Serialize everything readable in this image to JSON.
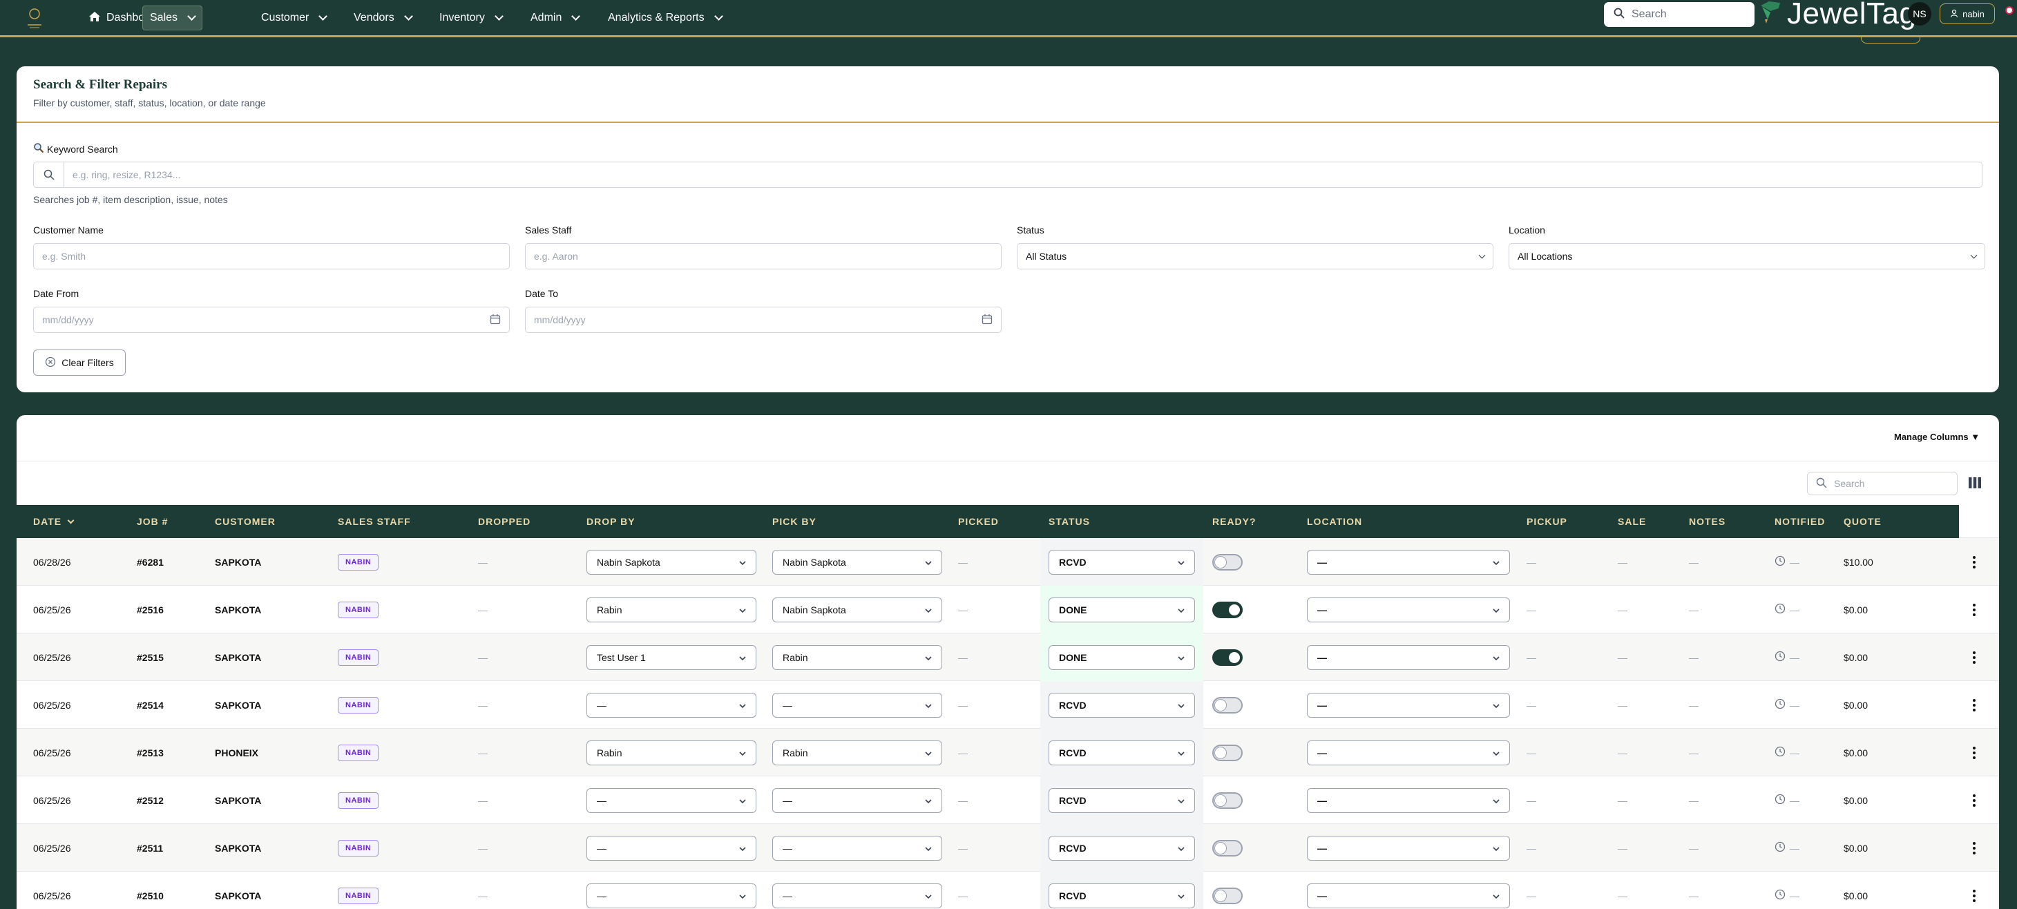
{
  "nav": {
    "items": [
      {
        "label": "Dashboard",
        "icon": "home-icon",
        "dropdown": false
      },
      {
        "label": "Sales",
        "dropdown": true,
        "active": true
      },
      {
        "label": "Customer",
        "dropdown": true
      },
      {
        "label": "Vendors",
        "dropdown": true
      },
      {
        "label": "Inventory",
        "dropdown": true
      },
      {
        "label": "Admin",
        "dropdown": true
      },
      {
        "label": "Analytics & Reports",
        "dropdown": true
      }
    ],
    "search_placeholder": "Search",
    "brand": "JewelTag",
    "avatar_initials": "NS",
    "user": "nabin"
  },
  "filters": {
    "title": "Search & Filter Repairs",
    "subtitle": "Filter by customer, staff, status, location, or date range",
    "keyword_label": "Keyword Search",
    "keyword_placeholder": "e.g. ring, resize, R1234...",
    "keyword_hint": "Searches job #, item description, issue, notes",
    "customer_label": "Customer Name",
    "customer_placeholder": "e.g. Smith",
    "staff_label": "Sales Staff",
    "staff_placeholder": "e.g. Aaron",
    "status_label": "Status",
    "status_value": "All Status",
    "location_label": "Location",
    "location_value": "All Locations",
    "date_from_label": "Date From",
    "date_from_placeholder": "mm/dd/yyyy",
    "date_to_label": "Date To",
    "date_to_placeholder": "mm/dd/yyyy",
    "clear_label": "Clear Filters"
  },
  "table": {
    "manage_columns": "Manage Columns ▼",
    "search_placeholder": "Search",
    "columns": [
      "DATE",
      "JOB #",
      "CUSTOMER",
      "SALES STAFF",
      "DROPPED",
      "DROP BY",
      "PICK BY",
      "PICKED",
      "STATUS",
      "READY?",
      "LOCATION",
      "PICKUP",
      "SALE",
      "NOTES",
      "NOTIFIED",
      "QUOTE"
    ],
    "rows": [
      {
        "date": "06/28/26",
        "job": "#6281",
        "customer": "SAPKOTA",
        "staff": "NABIN",
        "dropped": "—",
        "drop_by": "Nabin Sapkota",
        "pick_by": "Nabin Sapkota",
        "picked": "—",
        "status": "RCVD",
        "ready": false,
        "location": "—",
        "pickup": "—",
        "sale": "—",
        "notes": "—",
        "notified": "—",
        "quote": "$10.00"
      },
      {
        "date": "06/25/26",
        "job": "#2516",
        "customer": "SAPKOTA",
        "staff": "NABIN",
        "dropped": "—",
        "drop_by": "Rabin",
        "pick_by": "Nabin Sapkota",
        "picked": "—",
        "status": "DONE",
        "ready": true,
        "location": "—",
        "pickup": "—",
        "sale": "—",
        "notes": "—",
        "notified": "—",
        "quote": "$0.00"
      },
      {
        "date": "06/25/26",
        "job": "#2515",
        "customer": "SAPKOTA",
        "staff": "NABIN",
        "dropped": "—",
        "drop_by": "Test User 1",
        "pick_by": "Rabin",
        "picked": "—",
        "status": "DONE",
        "ready": true,
        "location": "—",
        "pickup": "—",
        "sale": "—",
        "notes": "—",
        "notified": "—",
        "quote": "$0.00"
      },
      {
        "date": "06/25/26",
        "job": "#2514",
        "customer": "SAPKOTA",
        "staff": "NABIN",
        "dropped": "—",
        "drop_by": "—",
        "pick_by": "—",
        "picked": "—",
        "status": "RCVD",
        "ready": false,
        "location": "—",
        "pickup": "—",
        "sale": "—",
        "notes": "—",
        "notified": "—",
        "quote": "$0.00"
      },
      {
        "date": "06/25/26",
        "job": "#2513",
        "customer": "PHONEIX",
        "staff": "NABIN",
        "dropped": "—",
        "drop_by": "Rabin",
        "pick_by": "Rabin",
        "picked": "—",
        "status": "RCVD",
        "ready": false,
        "location": "—",
        "pickup": "—",
        "sale": "—",
        "notes": "—",
        "notified": "—",
        "quote": "$0.00"
      },
      {
        "date": "06/25/26",
        "job": "#2512",
        "customer": "SAPKOTA",
        "staff": "NABIN",
        "dropped": "—",
        "drop_by": "—",
        "pick_by": "—",
        "picked": "—",
        "status": "RCVD",
        "ready": false,
        "location": "—",
        "pickup": "—",
        "sale": "—",
        "notes": "—",
        "notified": "—",
        "quote": "$0.00"
      },
      {
        "date": "06/25/26",
        "job": "#2511",
        "customer": "SAPKOTA",
        "staff": "NABIN",
        "dropped": "—",
        "drop_by": "—",
        "pick_by": "—",
        "picked": "—",
        "status": "RCVD",
        "ready": false,
        "location": "—",
        "pickup": "—",
        "sale": "—",
        "notes": "—",
        "notified": "—",
        "quote": "$0.00"
      },
      {
        "date": "06/25/26",
        "job": "#2510",
        "customer": "SAPKOTA",
        "staff": "NABIN",
        "dropped": "—",
        "drop_by": "—",
        "pick_by": "—",
        "picked": "—",
        "status": "RCVD",
        "ready": false,
        "location": "—",
        "pickup": "—",
        "sale": "—",
        "notes": "—",
        "notified": "—",
        "quote": "$0.00"
      }
    ]
  },
  "colors": {
    "header_bg": "#1e3c36",
    "accent_gold": "#c9a54c",
    "badge_purple": "#6d28d9",
    "done_bg": "#ecfdf3",
    "rcvd_bg": "#f3f4f6"
  }
}
